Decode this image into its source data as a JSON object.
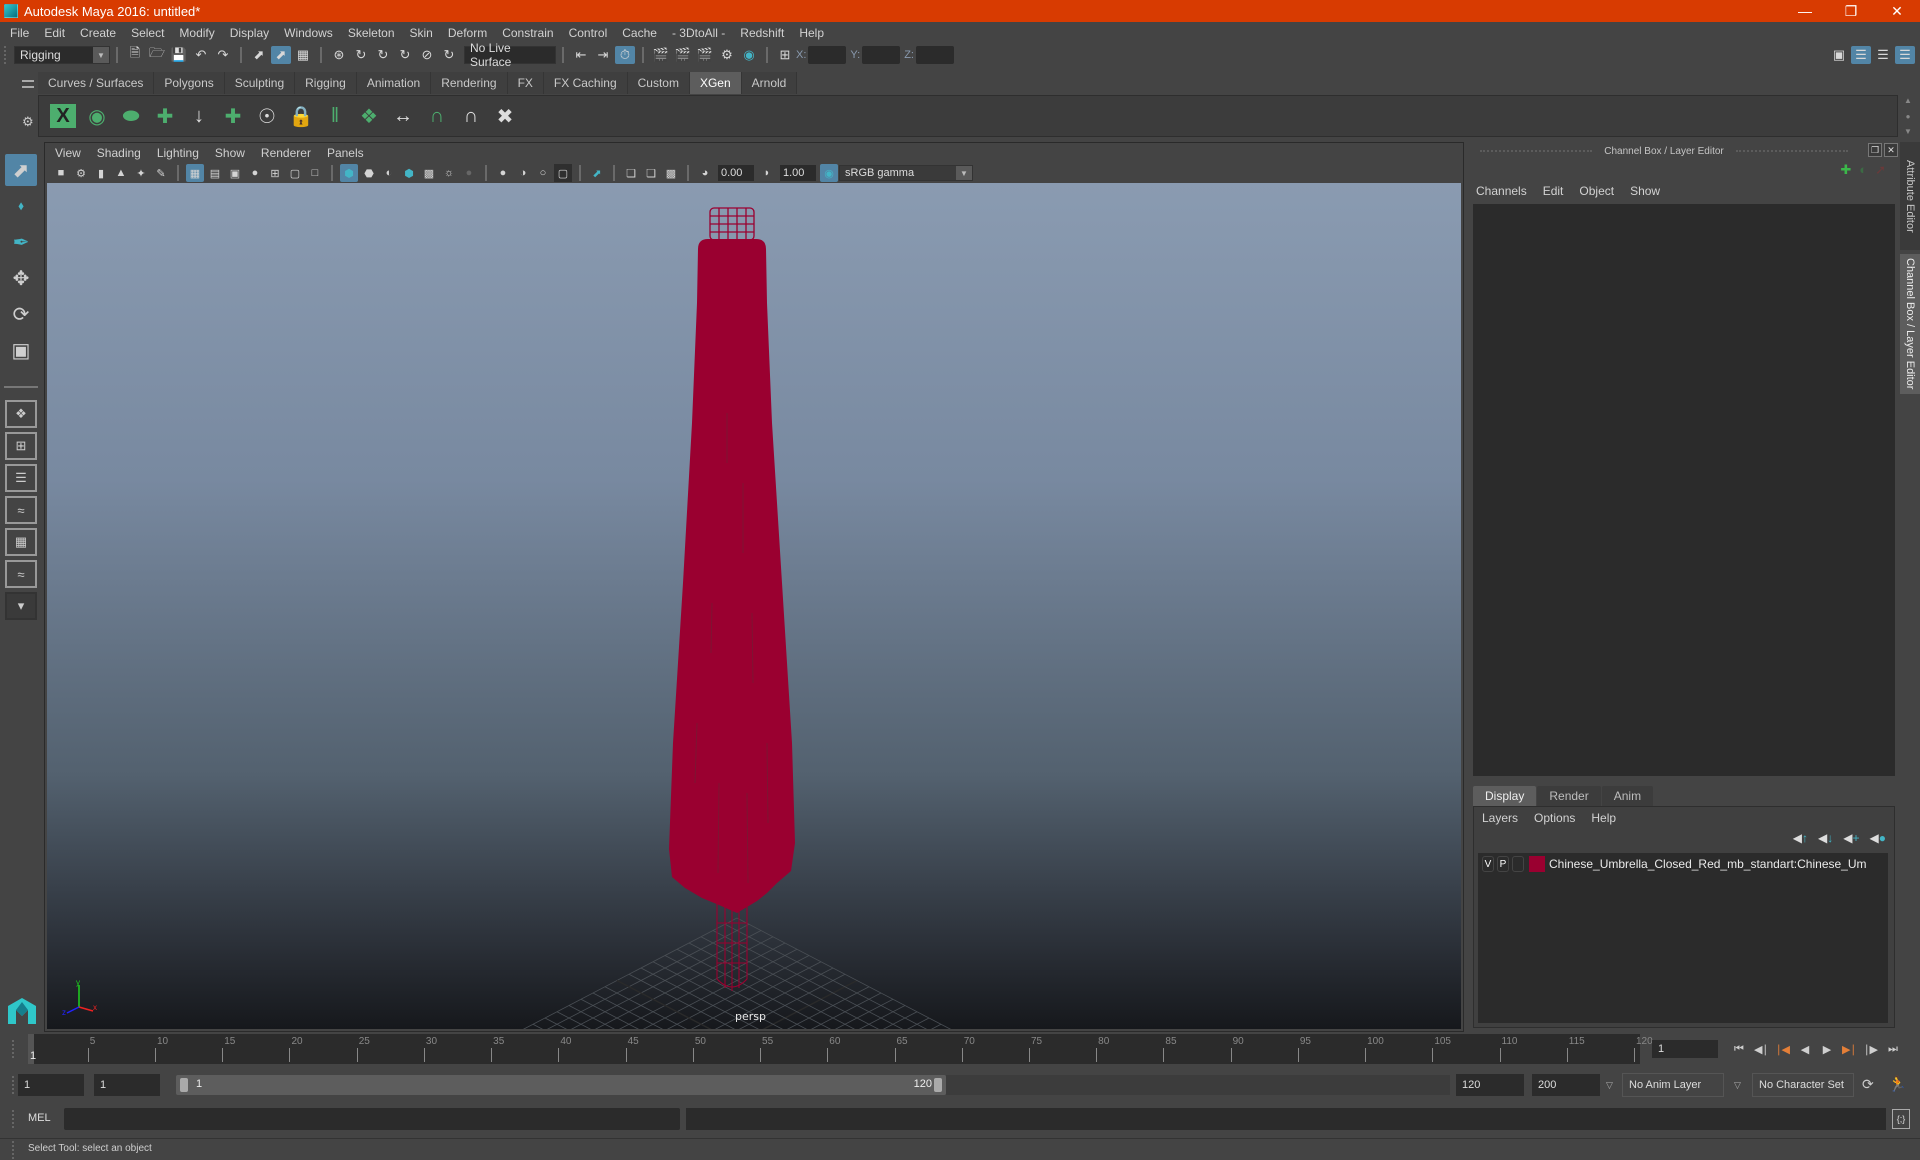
{
  "window": {
    "title": "Autodesk Maya 2016: untitled*",
    "controls": [
      "minimize",
      "restore",
      "close"
    ]
  },
  "menubar": [
    "File",
    "Edit",
    "Create",
    "Select",
    "Modify",
    "Display",
    "Windows",
    "Skeleton",
    "Skin",
    "Deform",
    "Constrain",
    "Control",
    "Cache",
    "- 3DtoAll -",
    "Redshift",
    "Help"
  ],
  "statusline": {
    "menuset": "Rigging",
    "live_surface": "No Live Surface",
    "xyz_labels": [
      "X:",
      "Y:",
      "Z:"
    ],
    "xyz_values": [
      "",
      "",
      ""
    ]
  },
  "shelf": {
    "tabs": [
      "Curves / Surfaces",
      "Polygons",
      "Sculpting",
      "Rigging",
      "Animation",
      "Rendering",
      "FX",
      "FX Caching",
      "Custom",
      "XGen",
      "Arnold"
    ],
    "active_tab": "XGen",
    "icons": [
      "xgen-window-icon",
      "xgen-preview-icon",
      "xgen-clear-preview-icon",
      "add-guides-icon",
      "sculpt-guides-icon",
      "add-guide-icon",
      "select-guide-icon",
      "lock-guide-icon",
      "guide-length-icon",
      "density-map-icon",
      "flip-guides-icon",
      "guides-to-curves-icon",
      "curves-to-guides-icon",
      "delete-guides-icon"
    ]
  },
  "viewport": {
    "menu": [
      "View",
      "Shading",
      "Lighting",
      "Show",
      "Renderer",
      "Panels"
    ],
    "exposure": "0.00",
    "gamma": "1.00",
    "color_space": "sRGB gamma",
    "camera": "persp",
    "axis_labels": [
      "x",
      "y",
      "z"
    ],
    "model_color": "#9a0030"
  },
  "channel_box": {
    "title": "Channel Box / Layer Editor",
    "menu": [
      "Channels",
      "Edit",
      "Object",
      "Show"
    ]
  },
  "layer_editor": {
    "tabs": [
      "Display",
      "Render",
      "Anim"
    ],
    "active_tab": "Display",
    "menu": [
      "Layers",
      "Options",
      "Help"
    ],
    "layers": [
      {
        "visible": "V",
        "playback": "P",
        "color": "#9a0030",
        "name": "Chinese_Umbrella_Closed_Red_mb_standart:Chinese_Um"
      }
    ]
  },
  "side_tabs": [
    "Attribute Editor",
    "Channel Box / Layer Editor"
  ],
  "timeline": {
    "ticks": [
      5,
      10,
      15,
      20,
      25,
      30,
      35,
      40,
      45,
      50,
      55,
      60,
      65,
      70,
      75,
      80,
      85,
      90,
      95,
      100,
      105,
      110,
      115,
      120
    ],
    "min": 1,
    "max": 120,
    "current": "1",
    "current_frame_field": "1"
  },
  "range": {
    "start": "1",
    "inner_start": "1",
    "slider_start_label": "1",
    "slider_end_label": "120",
    "end": "120",
    "outer_end": "200",
    "anim_layer": "No Anim Layer",
    "character_set": "No Character Set"
  },
  "command_line": {
    "language": "MEL",
    "input": "",
    "output": ""
  },
  "help_line": "Select Tool: select an object"
}
